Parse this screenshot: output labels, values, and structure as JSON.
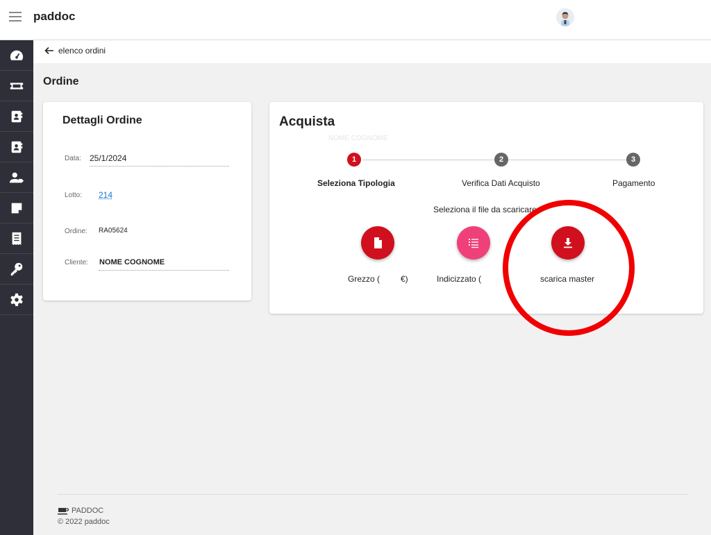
{
  "app": {
    "title": "paddoc"
  },
  "sidebar": {
    "items": [
      {
        "icon": "dashboard-icon"
      },
      {
        "icon": "ticket-icon"
      },
      {
        "icon": "contact-book-icon"
      },
      {
        "icon": "address-book-icon"
      },
      {
        "icon": "user-tag-icon"
      },
      {
        "icon": "note-icon"
      },
      {
        "icon": "receipt-icon"
      },
      {
        "icon": "key-icon"
      },
      {
        "icon": "gear-icon"
      }
    ]
  },
  "subbar": {
    "back_label": "elenco ordini"
  },
  "page": {
    "title": "Ordine"
  },
  "details": {
    "title": "Dettagli Ordine",
    "data_label": "Data:",
    "data_value": "25/1/2024",
    "lotto_label": "Lotto:",
    "lotto_value": "214",
    "ordine_label": "Ordine:",
    "ordine_value": "RA05624",
    "cliente_label": "Cliente:",
    "cliente_value": "NOME COGNOME"
  },
  "buy": {
    "title": "Acquista",
    "ghost": "NOME COGNOME",
    "steps": [
      {
        "number": "1",
        "label": "Seleziona Tipologia",
        "color": "#d0101e"
      },
      {
        "number": "2",
        "label": "Verifica Dati Acquisto",
        "color": "#666666"
      },
      {
        "number": "3",
        "label": "Pagamento",
        "color": "#666666"
      }
    ],
    "instruction": "Seleziona il file da scaricare",
    "options": [
      {
        "label_left": "Grezzo (",
        "label_right": "€)",
        "icon": "file-icon",
        "color": "#d0101e"
      },
      {
        "label_left": "Indicizzato (",
        "label_right": "",
        "icon": "list-icon",
        "color": "#f0407a"
      },
      {
        "label_left": "scarica master",
        "label_right": "",
        "icon": "download-icon",
        "color": "#d0101e"
      }
    ]
  },
  "footer": {
    "brand": "PADDOC",
    "copyright": "© 2022 paddoc"
  }
}
